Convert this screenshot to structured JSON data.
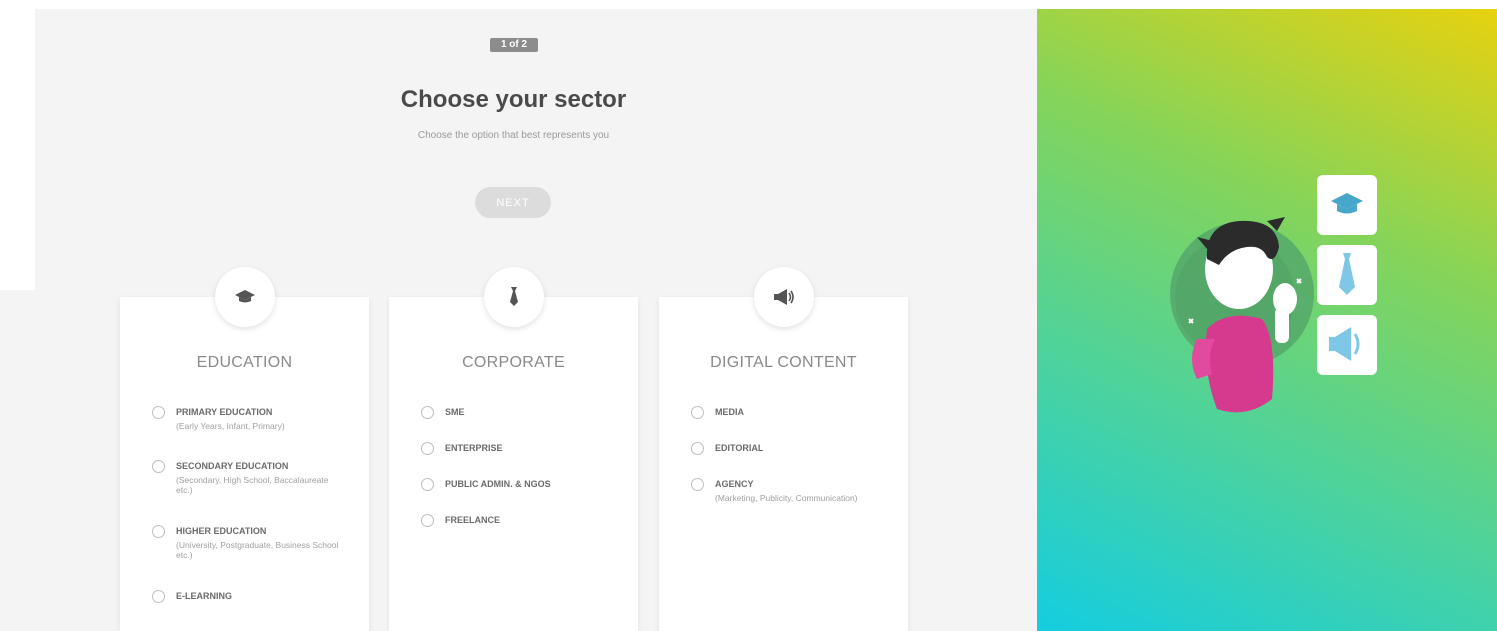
{
  "step": {
    "label": "1 of 2"
  },
  "header": {
    "title": "Choose your sector",
    "subtitle": "Choose the option that best represents you"
  },
  "next_button": {
    "label": "NEXT"
  },
  "cards": [
    {
      "title": "EDUCATION",
      "icon": "graduation-cap-icon",
      "options": [
        {
          "label": "PRIMARY EDUCATION",
          "desc": "(Early Years, Infant, Primary)"
        },
        {
          "label": "SECONDARY EDUCATION",
          "desc": "(Secondary, High School, Baccalaureate etc.)"
        },
        {
          "label": "HIGHER EDUCATION",
          "desc": "(University, Postgraduate, Business School etc.)"
        },
        {
          "label": "E-LEARNING",
          "desc": ""
        }
      ]
    },
    {
      "title": "CORPORATE",
      "icon": "tie-icon",
      "options": [
        {
          "label": "SME"
        },
        {
          "label": "ENTERPRISE"
        },
        {
          "label": "PUBLIC ADMIN. & NGOS"
        },
        {
          "label": "FREELANCE"
        }
      ]
    },
    {
      "title": "DIGITAL CONTENT",
      "icon": "megaphone-icon",
      "options": [
        {
          "label": "MEDIA"
        },
        {
          "label": "EDITORIAL"
        },
        {
          "label": "AGENCY",
          "desc": "(Marketing, Publicity, Communication)"
        }
      ]
    }
  ],
  "colors": {
    "background": "#f4f4f4",
    "card": "#ffffff",
    "title": "#4a4a4a",
    "gradient_start": "#14cde0",
    "gradient_mid": "#84d45a",
    "gradient_end": "#e7d20f"
  }
}
